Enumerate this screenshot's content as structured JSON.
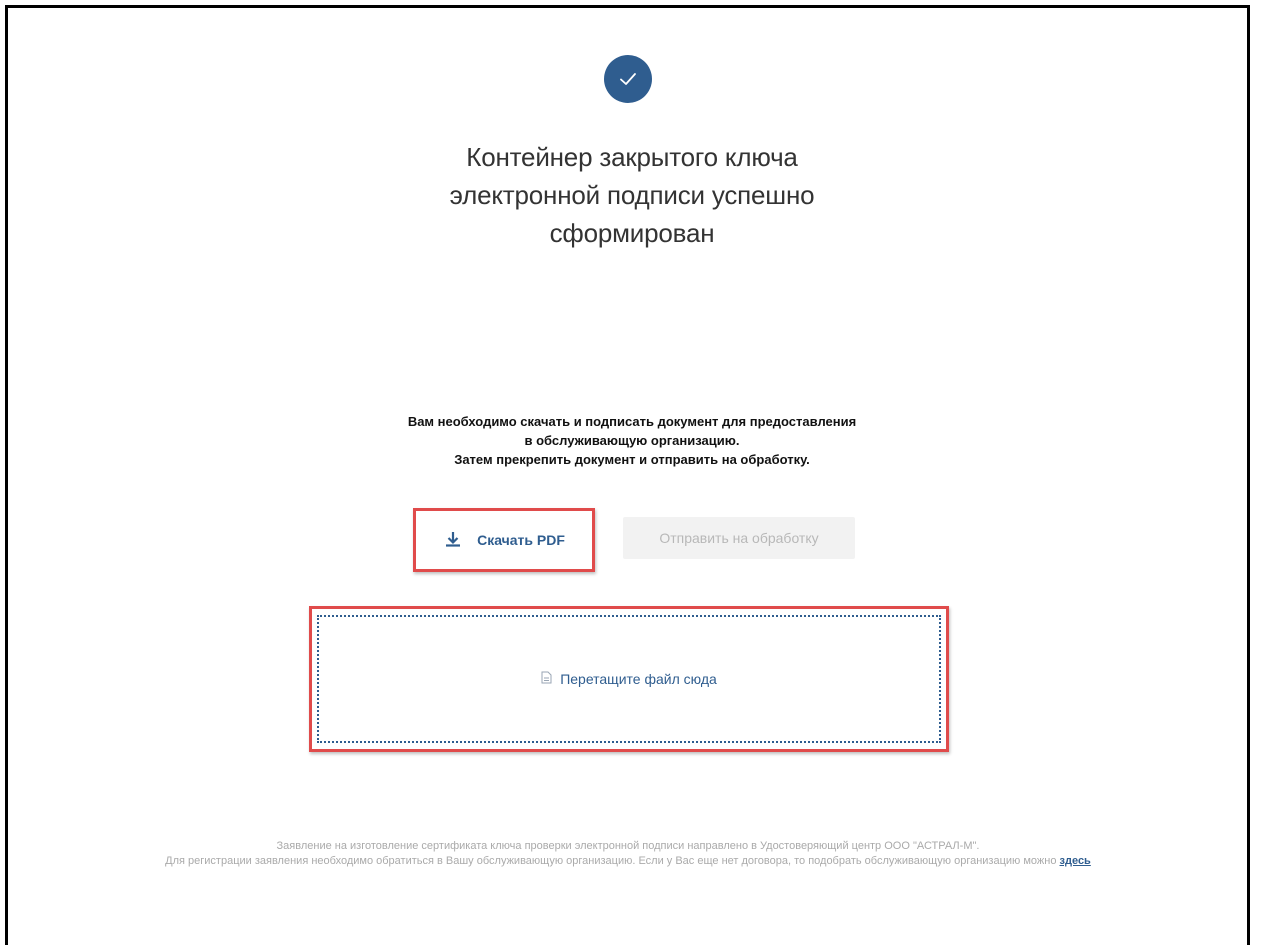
{
  "success": {
    "icon": "check-circle-icon",
    "title_line1": "Контейнер закрытого ключа",
    "title_line2": "электронной подписи успешно",
    "title_line3": "сформирован"
  },
  "instructions": {
    "line1": "Вам необходимо скачать и подписать документ для предоставления",
    "line2": "в обслуживающую организацию.",
    "line3": "Затем прекрепить документ и отправить на обработку."
  },
  "actions": {
    "download_label": "Скачать PDF",
    "download_icon": "download-icon",
    "submit_label": "Отправить на обработку"
  },
  "dropzone": {
    "icon": "file-icon",
    "label": "Перетащите файл сюда"
  },
  "footer": {
    "line1": "Заявление на изготовление сертификата ключа проверки электронной подписи направлено в Удостоверяющий центр ООО \"АСТРАЛ-М\".",
    "line2": "Для регистрации заявления необходимо обратиться в Вашу обслуживающую организацию. Если у Вас еще нет договора, то подобрать обслуживающую организацию можно",
    "link_label": "здесь"
  },
  "colors": {
    "accent": "#2f5d8f",
    "highlight": "#e04b4b",
    "disabled_bg": "#f2f2f2",
    "disabled_text": "#b8b8b8"
  }
}
